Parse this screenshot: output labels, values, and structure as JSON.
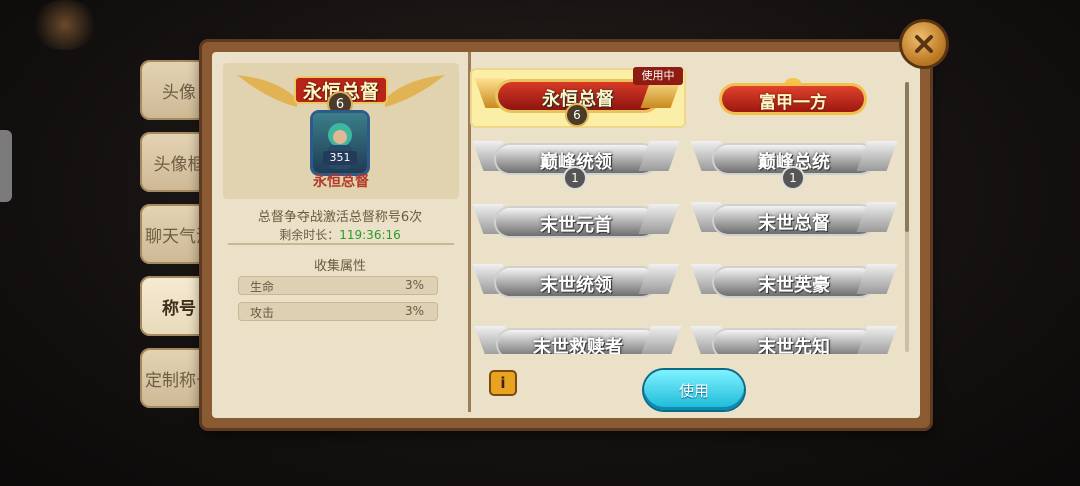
{
  "tabs": [
    "头像",
    "头像框",
    "聊天气泡",
    "称号",
    "定制称号"
  ],
  "active_tab_index": 3,
  "preview": {
    "banner_title": "永恒总督",
    "banner_level": "6",
    "portrait_level": "351",
    "name": "永恒总督"
  },
  "description": "总督争夺战激活总督称号6次",
  "timer": {
    "label": "剩余时长：",
    "value": "119:36:16"
  },
  "attributes": {
    "title": "收集属性",
    "rows": [
      {
        "label": "生命",
        "value": "3%"
      },
      {
        "label": "攻击",
        "value": "3%"
      }
    ]
  },
  "titles": [
    {
      "text": "永恒总督",
      "level": "6",
      "style": "gold",
      "tag": "使用中"
    },
    {
      "text": "富甲一方",
      "style": "rich"
    },
    {
      "text": "巅峰统领",
      "level": "1",
      "style": "silver"
    },
    {
      "text": "巅峰总统",
      "level": "1",
      "style": "silver"
    },
    {
      "text": "末世元首",
      "style": "silver"
    },
    {
      "text": "末世总督",
      "style": "silver"
    },
    {
      "text": "末世统领",
      "style": "silver"
    },
    {
      "text": "末世英豪",
      "style": "silver"
    },
    {
      "text": "末世救赎者",
      "style": "silver"
    },
    {
      "text": "末世先知",
      "style": "silver"
    }
  ],
  "buttons": {
    "use": "使用",
    "info": "i"
  },
  "colors": {
    "accent_gold": "#e8c25a",
    "use_button": "#19b8d8",
    "timer_green": "#2a9a2a",
    "name_red": "#b23a2a"
  }
}
